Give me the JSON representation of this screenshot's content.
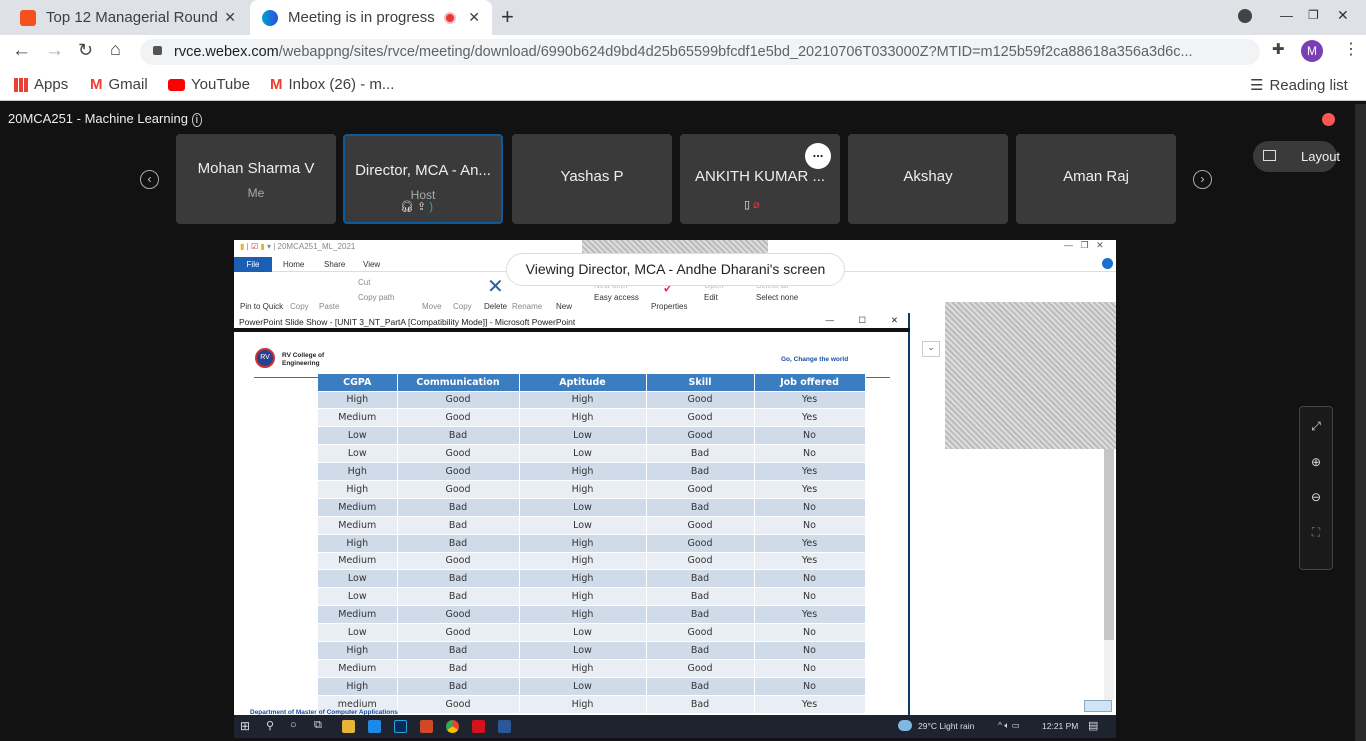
{
  "browser": {
    "tabs": [
      {
        "title": "Top 12 Managerial Round",
        "active": false
      },
      {
        "title": "Meeting is in progress",
        "active": true
      }
    ],
    "new_tab": "+",
    "url_domain": "rvce.webex.com",
    "url_path": "/webappng/sites/rvce/meeting/download/6990b624d9bd4d25b65599bfcdf1e5bd_20210706T033000Z?MTID=m125b59f2ca88618a356a3d6c...",
    "profile_initial": "M",
    "bookmarks": [
      "Apps",
      "Gmail",
      "YouTube",
      "Inbox (26) - m..."
    ],
    "reading_list": "Reading list"
  },
  "meeting": {
    "title": "20MCA251 - Machine Learning",
    "participants": [
      {
        "name": "Mohan Sharma V",
        "sub": "Me"
      },
      {
        "name": "Director, MCA - An...",
        "sub": "Host"
      },
      {
        "name": "Yashas P",
        "sub": ""
      },
      {
        "name": "ANKITH KUMAR ...",
        "sub": ""
      },
      {
        "name": "Akshay",
        "sub": ""
      },
      {
        "name": "Aman Raj",
        "sub": ""
      }
    ],
    "more": "...",
    "layout_label": "Layout",
    "banner": "Viewing Director, MCA - Andhe Dharani's screen"
  },
  "explorer": {
    "title": "20MCA251_ML_2021",
    "tabs": [
      "File",
      "Home",
      "Share",
      "View"
    ],
    "ribbon": [
      "Pin to Quick",
      "Copy",
      "Paste",
      "Cut",
      "Copy path",
      "Move",
      "Copy",
      "Delete",
      "Rename",
      "New",
      "New item",
      "Easy access",
      "Properties",
      "Open",
      "Edit",
      "Select all",
      "Select none"
    ]
  },
  "ppt": {
    "title": "PowerPoint Slide Show - [UNIT 3_NT_PartA [Compatibility Mode]] - Microsoft PowerPoint",
    "college": "RV College of Engineering",
    "logo": "RV",
    "tagline": "Go, Change the world",
    "footer": "Department of Master of Computer Applications",
    "table": {
      "headers": [
        "CGPA",
        "Communication",
        "Aptitude",
        "Skill",
        "Job offered"
      ],
      "rows": [
        [
          "High",
          "Good",
          "High",
          "Good",
          "Yes"
        ],
        [
          "Medium",
          "Good",
          "High",
          "Good",
          "Yes"
        ],
        [
          "Low",
          "Bad",
          "Low",
          "Good",
          "No"
        ],
        [
          "Low",
          "Good",
          "Low",
          "Bad",
          "No"
        ],
        [
          "Hgh",
          "Good",
          "High",
          "Bad",
          "Yes"
        ],
        [
          "High",
          "Good",
          "High",
          "Good",
          "Yes"
        ],
        [
          "Medium",
          "Bad",
          "Low",
          "Bad",
          "No"
        ],
        [
          "Medium",
          "Bad",
          "Low",
          "Good",
          "No"
        ],
        [
          "High",
          "Bad",
          "High",
          "Good",
          "Yes"
        ],
        [
          "Medium",
          "Good",
          "High",
          "Good",
          "Yes"
        ],
        [
          "Low",
          "Bad",
          "High",
          "Bad",
          "No"
        ],
        [
          "Low",
          "Bad",
          "High",
          "Bad",
          "No"
        ],
        [
          "Medium",
          "Good",
          "High",
          "Bad",
          "Yes"
        ],
        [
          "Low",
          "Good",
          "Low",
          "Good",
          "No"
        ],
        [
          "High",
          "Bad",
          "Low",
          "Bad",
          "No"
        ],
        [
          "Medium",
          "Bad",
          "High",
          "Good",
          "No"
        ],
        [
          "High",
          "Bad",
          "Low",
          "Bad",
          "No"
        ],
        [
          "medium",
          "Good",
          "High",
          "Bad",
          "Yes"
        ]
      ]
    }
  },
  "taskbar": {
    "weather": "29°C  Light rain",
    "time": "12:21 PM"
  }
}
